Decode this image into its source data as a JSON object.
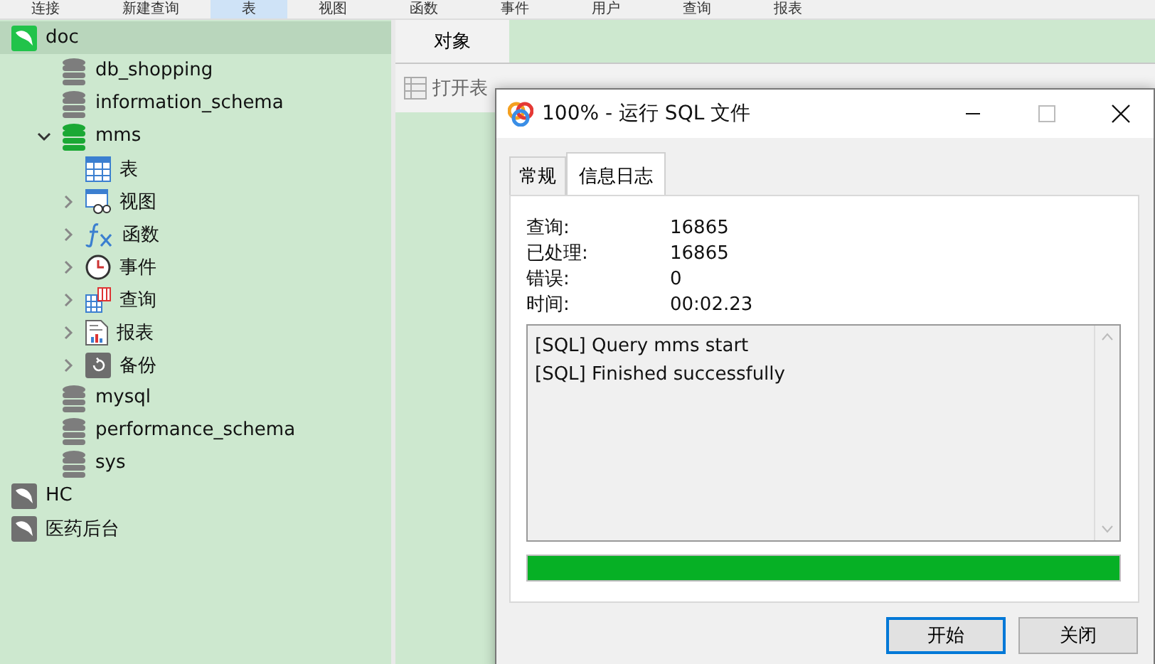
{
  "toolbar": [
    {
      "label": "连接",
      "selected": false
    },
    {
      "label": "新建查询",
      "selected": false
    },
    {
      "label": "表",
      "selected": true
    },
    {
      "label": "视图",
      "selected": false
    },
    {
      "label": "函数",
      "selected": false
    },
    {
      "label": "事件",
      "selected": false
    },
    {
      "label": "用户",
      "selected": false
    },
    {
      "label": "查询",
      "selected": false
    },
    {
      "label": "报表",
      "selected": false
    }
  ],
  "sidebar": {
    "tree": [
      {
        "label": "doc",
        "kind": "connection",
        "active": true,
        "selected": true,
        "children": [
          {
            "label": "db_shopping",
            "kind": "database",
            "active": false,
            "selected": false
          },
          {
            "label": "information_schema",
            "kind": "database",
            "active": false,
            "selected": false
          },
          {
            "label": "mms",
            "kind": "database",
            "active": true,
            "selected": false,
            "expanded": true,
            "children": [
              {
                "label": "表",
                "kind": "tables",
                "selected": false
              },
              {
                "label": "视图",
                "kind": "views",
                "selected": false,
                "expanded": false
              },
              {
                "label": "函数",
                "kind": "functions",
                "selected": false,
                "expanded": false
              },
              {
                "label": "事件",
                "kind": "events",
                "selected": false,
                "expanded": false
              },
              {
                "label": "查询",
                "kind": "queries",
                "selected": false,
                "expanded": false
              },
              {
                "label": "报表",
                "kind": "reports",
                "selected": false,
                "expanded": false
              },
              {
                "label": "备份",
                "kind": "backups",
                "selected": false,
                "expanded": false
              }
            ]
          },
          {
            "label": "mysql",
            "kind": "database",
            "active": false,
            "selected": false
          },
          {
            "label": "performance_schema",
            "kind": "database",
            "active": false,
            "selected": false
          },
          {
            "label": "sys",
            "kind": "database",
            "active": false,
            "selected": false
          }
        ]
      },
      {
        "label": "HC",
        "kind": "connection",
        "active": false,
        "selected": false
      },
      {
        "label": "医药后台",
        "kind": "connection",
        "active": false,
        "selected": false
      }
    ]
  },
  "main": {
    "tabs": [
      {
        "label": "对象",
        "selected": true
      }
    ],
    "actions": [
      "打开表"
    ]
  },
  "dialog": {
    "title": "100% - 运行 SQL 文件",
    "tabs": [
      {
        "label": "常规",
        "selected": false
      },
      {
        "label": "信息日志",
        "selected": true
      }
    ],
    "stats": [
      {
        "label": "查询:",
        "value": "16865"
      },
      {
        "label": "已处理:",
        "value": "16865"
      },
      {
        "label": "错误:",
        "value": "0"
      },
      {
        "label": "时间:",
        "value": "00:02.23"
      }
    ],
    "log": [
      "[SQL] Query mms start",
      "[SQL] Finished successfully"
    ],
    "progress": {
      "level": 1.0
    },
    "buttons": [
      {
        "label": "开始",
        "default": true
      },
      {
        "label": "关闭",
        "default": false
      }
    ]
  }
}
